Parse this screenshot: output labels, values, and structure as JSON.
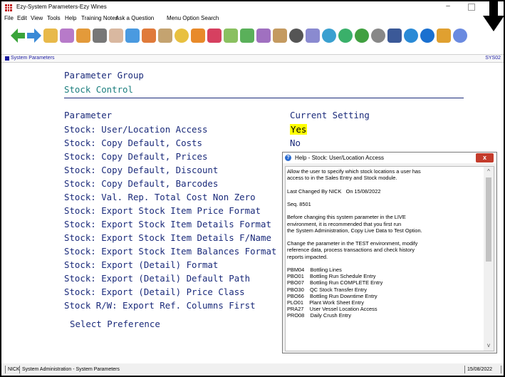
{
  "window": {
    "title": "Ezy-System Parameters-Ezy Wines",
    "minimize_glyph": "–"
  },
  "menu": [
    "File",
    "Edit",
    "View",
    "Tools",
    "Help",
    "Training Notes",
    "Ask a Question",
    "Menu Option Search"
  ],
  "toolbar": {
    "icons": [
      "back-icon",
      "forward-icon",
      "pencil-icon",
      "edit-icon",
      "clipboard-icon",
      "printer-icon",
      "eraser-icon",
      "calendar-icon",
      "users-icon",
      "wand-icon",
      "coins-icon",
      "cube-icon",
      "wine-glass-icon",
      "people-icon",
      "chart-icon",
      "flask-icon",
      "box-icon",
      "settings-gear-icon",
      "card-icon",
      "globe-icon",
      "recycle-icon",
      "dollar-icon",
      "news-icon",
      "facebook-icon",
      "refresh-icon",
      "info-icon",
      "download-icon",
      "help-icon"
    ]
  },
  "system_bar": {
    "label": "System Parameters",
    "code": "SYS02"
  },
  "main": {
    "group_heading": "Parameter Group",
    "group_name": "Stock Control",
    "param_heading": "Parameter",
    "setting_heading": "Current Setting",
    "parameters": [
      "Stock: User/Location Access",
      "Stock: Copy Default, Costs",
      "Stock: Copy Default, Prices",
      "Stock: Copy Default, Discount",
      "Stock: Copy Default, Barcodes",
      "Stock: Val. Rep. Total Cost Non Zero",
      "Stock: Export Stock Item Price Format",
      "Stock: Export Stock Item Details Format",
      "Stock: Export Stock Item Details F/Name",
      "Stock: Export Stock Item Balances Format",
      "Stock: Export (Detail) Format",
      "Stock: Export (Detail) Default Path",
      "Stock: Export (Detail) Price Class",
      "Stock R/W: Export Ref. Columns First"
    ],
    "settings": [
      "Yes",
      "No"
    ],
    "select_prompt": "Select Preference"
  },
  "help": {
    "title": "Help - Stock: User/Location Access",
    "close": "x",
    "text": "Allow the user to specify which stock locations a user has\naccess to in the Sales Entry and Stock module.\n\nLast Changed By NICK   On 15/08/2022\n\nSeq. 8501\n\nBefore changing this system parameter in the LIVE\nenvironment, it is recommended that you first run\nthe System Administration, Copy Live Data to Test Option.\n\nChange the parameter in the TEST environment, modify\nreference data, process transactions and check history\nreports impacted.\n\nPBM04    Bottling Lines\nPBO01    Bottling Run Schedule Entry\nPBO07    Bottling Run COMPLETE Entry\nPBO30    QC Stock Transfer Entry\nPBO66    Bottling Run Downtime Entry\nPLO01    Plant Work Sheet Entry\nPRA27    User Vessel Location Access\nPRO08    Daily Crush Entry",
    "scroll_up": "^",
    "scroll_down": "v"
  },
  "status": {
    "user": "NICK",
    "module": "System Administration - System Parameters",
    "date": "15/08/2022"
  }
}
